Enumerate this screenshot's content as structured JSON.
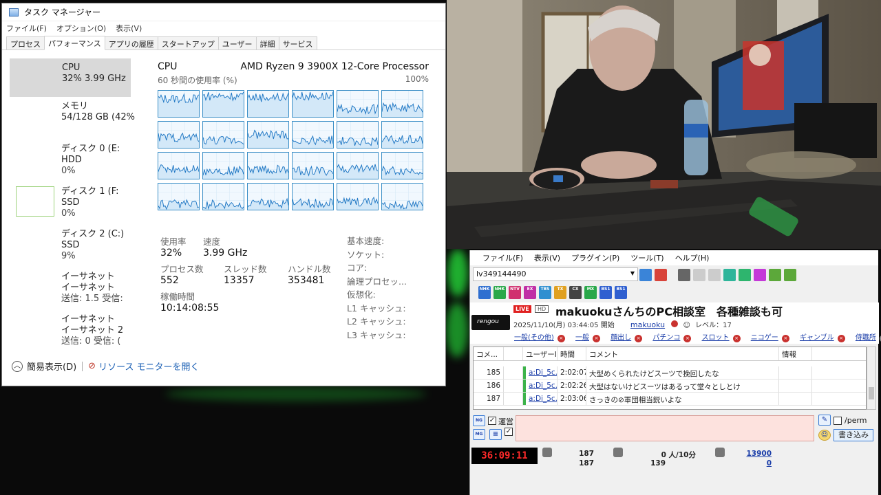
{
  "task_manager": {
    "title": "タスク マネージャー",
    "menu": [
      "ファイル(F)",
      "オプション(O)",
      "表示(V)"
    ],
    "tabs": [
      "プロセス",
      "パフォーマンス",
      "アプリの履歴",
      "スタートアップ",
      "ユーザー",
      "詳細",
      "サービス"
    ],
    "active_tab": "パフォーマンス",
    "sidebar": [
      {
        "l1": "CPU",
        "l2": "32% 3.99 GHz",
        "l3": ""
      },
      {
        "l1": "メモリ",
        "l2": "54/128 GB (42%",
        "l3": ""
      },
      {
        "l1": "ディスク 0 (E:",
        "l2": "HDD",
        "l3": "0%"
      },
      {
        "l1": "ディスク 1 (F:",
        "l2": "SSD",
        "l3": "0%"
      },
      {
        "l1": "ディスク 2 (C:)",
        "l2": "SSD",
        "l3": "9%"
      },
      {
        "l1": "イーサネット",
        "l2": "イーサネット",
        "l3": "送信: 1.5 受信:"
      },
      {
        "l1": "イーサネット",
        "l2": "イーサネット 2",
        "l3": "送信: 0 受信: ("
      }
    ],
    "cpu": {
      "title": "CPU",
      "model": "AMD Ryzen 9 3900X 12-Core Processor",
      "graph_label": "60 秒間の使用率 (%)",
      "graph_max": "100%",
      "core_levels": [
        0.7,
        0.8,
        0.75,
        0.8,
        0.3,
        0.35,
        0.4,
        0.3,
        0.5,
        0.3,
        0.25,
        0.3,
        0.4,
        0.3,
        0.35,
        0.3,
        0.4,
        0.3,
        0.2,
        0.2,
        0.25,
        0.25,
        0.3,
        0.2
      ]
    },
    "stats": {
      "usage_label": "使用率",
      "usage": "32%",
      "speed_label": "速度",
      "speed": "3.99 GHz",
      "proc_label": "プロセス数",
      "proc": "552",
      "thread_label": "スレッド数",
      "thread": "13357",
      "handle_label": "ハンドル数",
      "handle": "353481",
      "uptime_label": "稼働時間",
      "uptime": "10:14:08:55"
    },
    "info_labels": [
      "基本速度:",
      "ソケット:",
      "コア:",
      "論理プロセッ...",
      "仮想化:",
      "L1 キャッシュ:",
      "L2 キャッシュ:",
      "L3 キャッシュ:"
    ],
    "footer": {
      "fewer": "簡易表示(D)",
      "monitor": "リソース モニターを開く"
    }
  },
  "viewer": {
    "menu": [
      "ファイル(F)",
      "表示(V)",
      "プラグイン(P)",
      "ツール(T)",
      "ヘルプ(H)"
    ],
    "live_id": "lv349144490",
    "channels": [
      {
        "t": "NHK",
        "c": "#2f6fd0"
      },
      {
        "t": "NHK",
        "c": "#2aa84a"
      },
      {
        "t": "NTV",
        "c": "#d0306f"
      },
      {
        "t": "EX",
        "c": "#c02fa5"
      },
      {
        "t": "TBS",
        "c": "#2f8fd0"
      },
      {
        "t": "TX",
        "c": "#e0a020"
      },
      {
        "t": "CX",
        "c": "#444444"
      },
      {
        "t": "MX",
        "c": "#2aa84a"
      },
      {
        "t": "BS1",
        "c": "#2f5fd0"
      },
      {
        "t": "BS1",
        "c": "#2f5fd0"
      }
    ],
    "logo": "rengou",
    "badge_live": "LIVE",
    "badge_hd": "HD",
    "title": "makuokuさんちのPC相談室　各種雑談も可",
    "start": "2025/11/10(月) 03:44:05 開始",
    "owner": "makuoku",
    "level": "レベル：17",
    "categories": [
      "一般(その他)",
      "一般",
      "顔出し",
      "パチンコ",
      "スロット",
      "ニコゲー",
      "ギャンブル",
      "侍職所"
    ],
    "tail_link": "ma",
    "columns": [
      "コメ...",
      "",
      "ユーザーID",
      "時間",
      "コメント",
      "情報"
    ],
    "comments": [
      {
        "no": "185",
        "user": "a:Di_5c...",
        "time": "2:02:07",
        "text": "大型めくられたけどスーツで挽回したな"
      },
      {
        "no": "186",
        "user": "a:Di_5c...",
        "time": "2:02:26",
        "text": "大型はないけどスーツはあるって堂々としとけ"
      },
      {
        "no": "187",
        "user": "a:Di_5c...",
        "time": "2:03:06",
        "text": "さっきの⊘軍団相当鋭いよな"
      }
    ],
    "unei": "運営",
    "perm": "/perm",
    "write": "書き込み",
    "timer": "36:09:11",
    "count1": "187",
    "count2": "187",
    "viewers_now": "0 人/10分",
    "viewers_total": "139",
    "points1": "13900",
    "points2": "0"
  }
}
